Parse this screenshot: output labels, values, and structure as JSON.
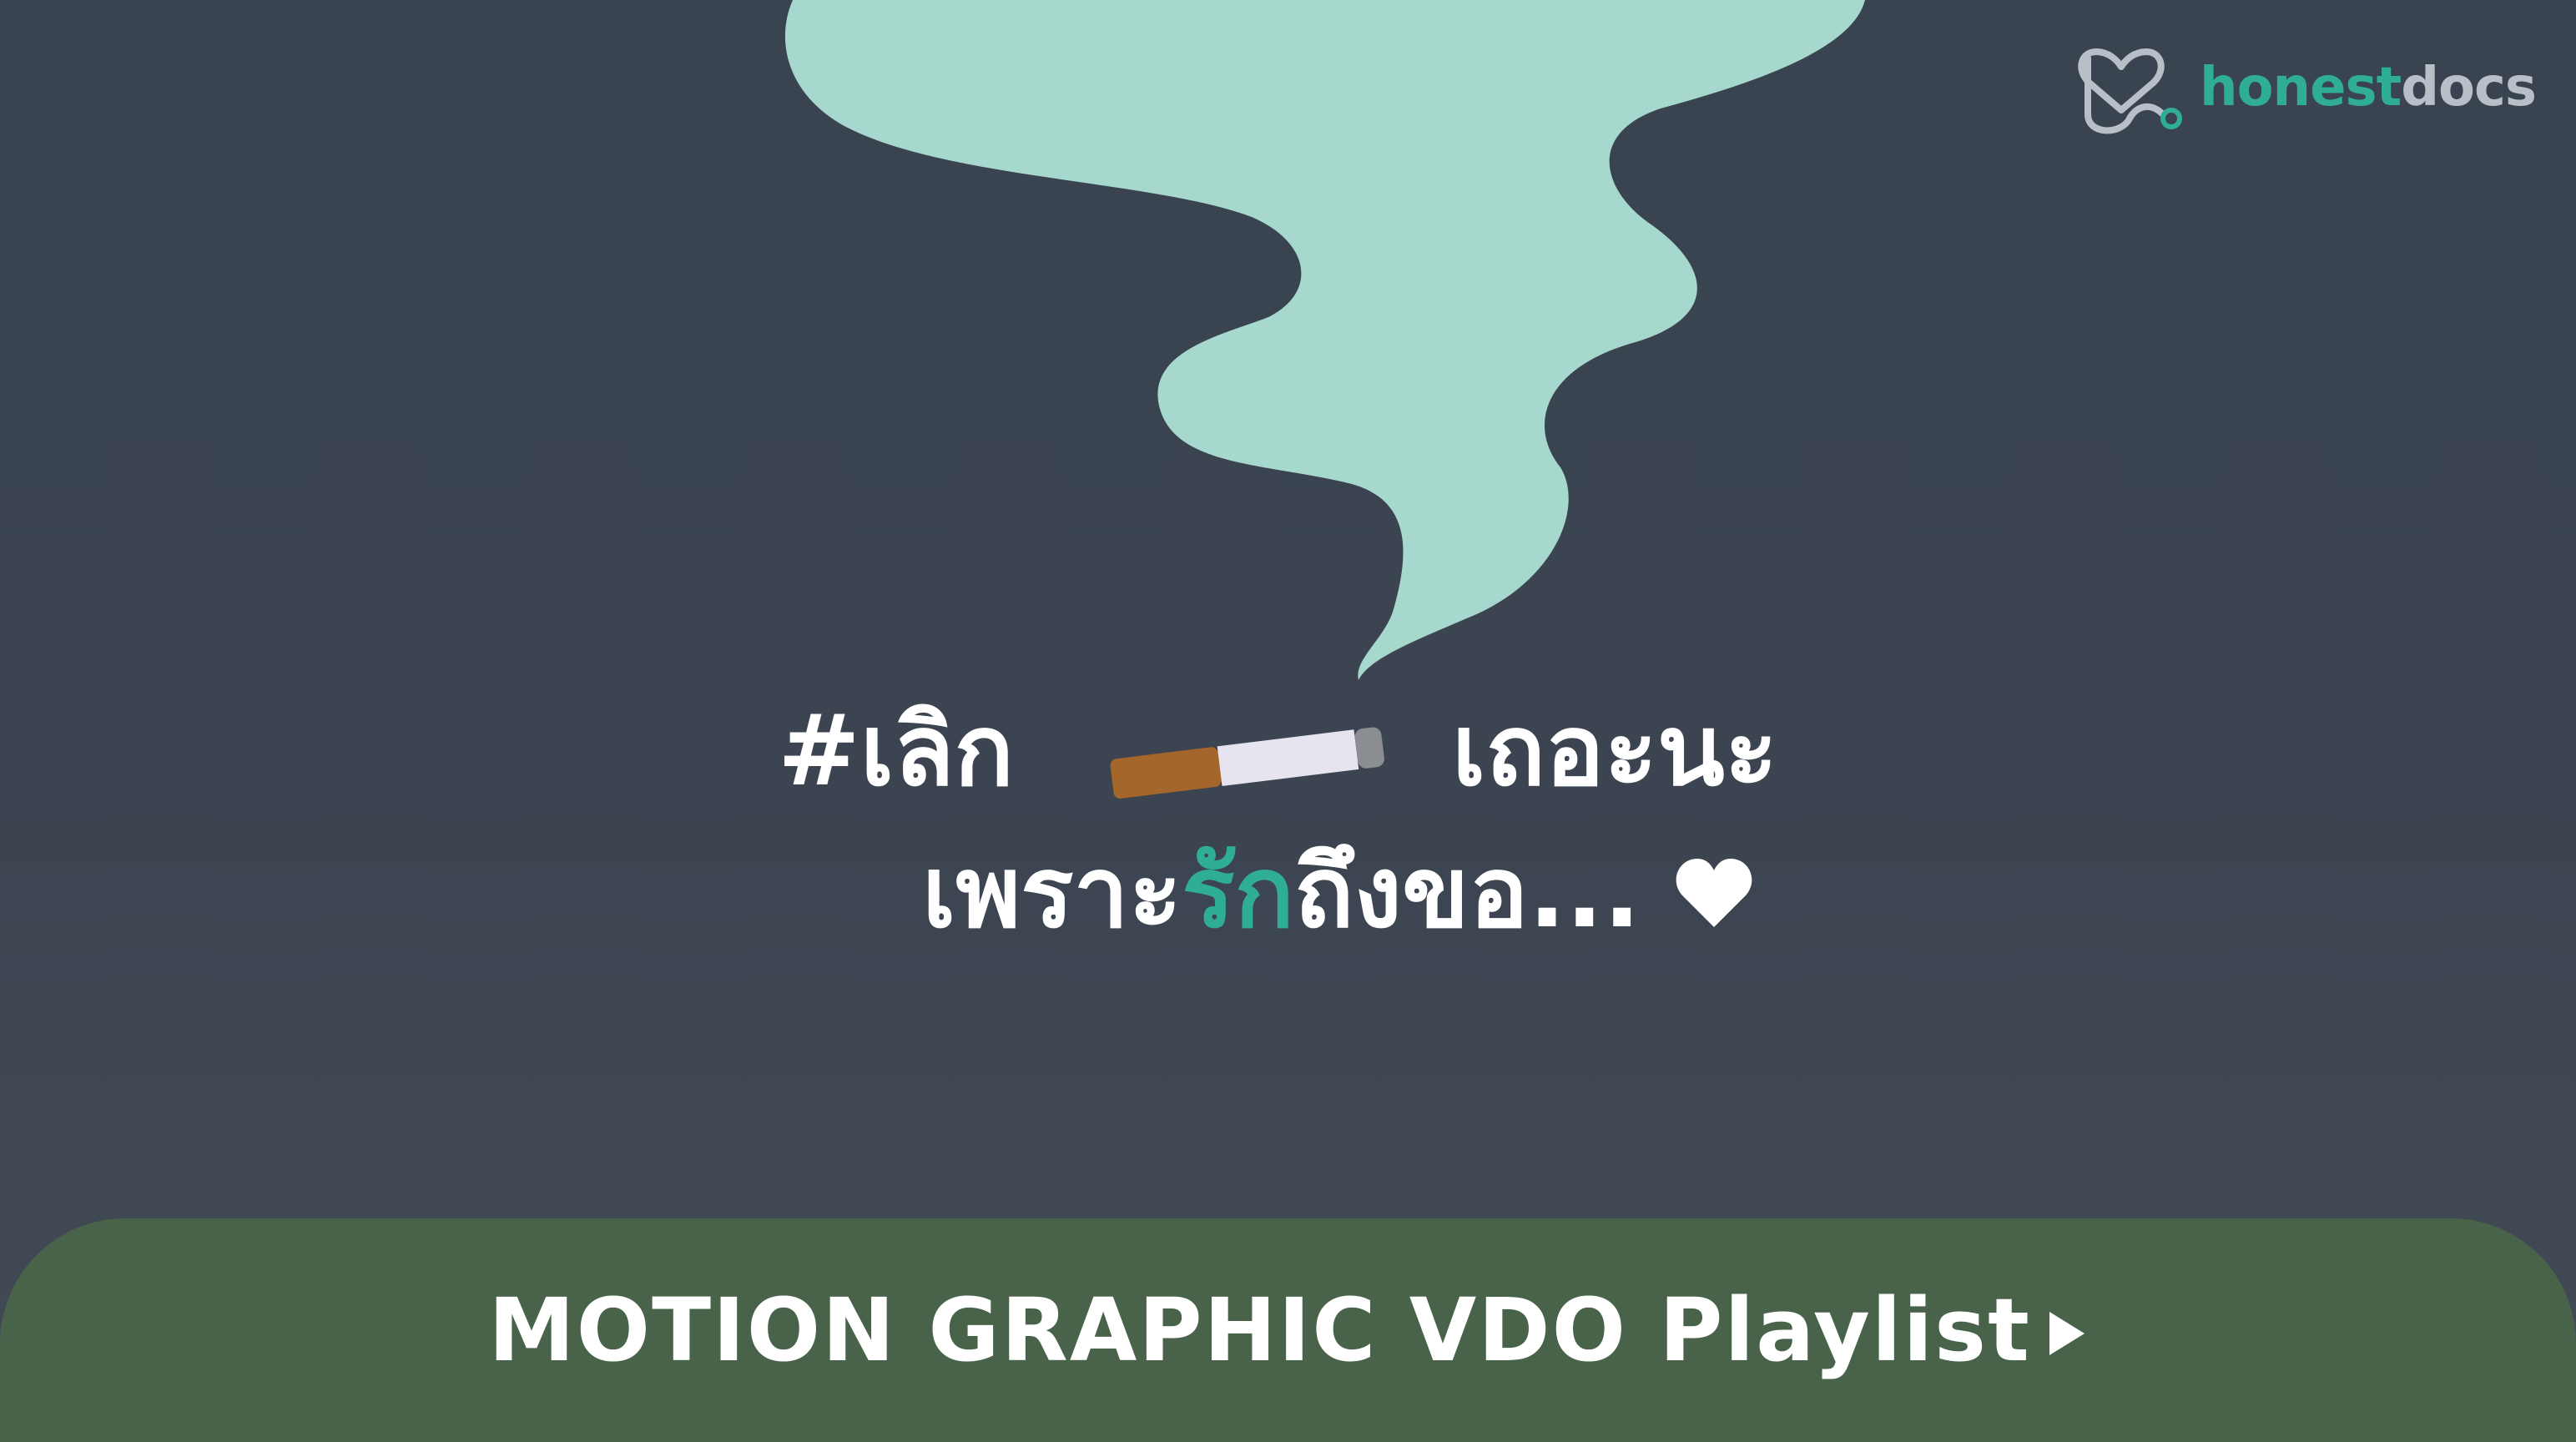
{
  "logo": {
    "name_part1": "honest",
    "name_part2": "docs",
    "icon": "stethoscope-heart-icon",
    "brand_color": "#2fae95"
  },
  "headline": {
    "line1_part1": "#เลิก",
    "line1_part2": "เถอะนะ",
    "line2_part1": "เพราะ",
    "line2_accent": "รัก",
    "line2_part2": "ถึงขอ...",
    "cigarette_icon": "cigarette-icon",
    "heart_icon": "heart-icon"
  },
  "banner": {
    "label": "MOTION GRAPHIC VDO Playlist",
    "icon": "play-triangle-icon",
    "background": "#486349"
  },
  "colors": {
    "background": "#3b4450",
    "smoke": "#a6d8ce",
    "accent": "#2fae95"
  }
}
